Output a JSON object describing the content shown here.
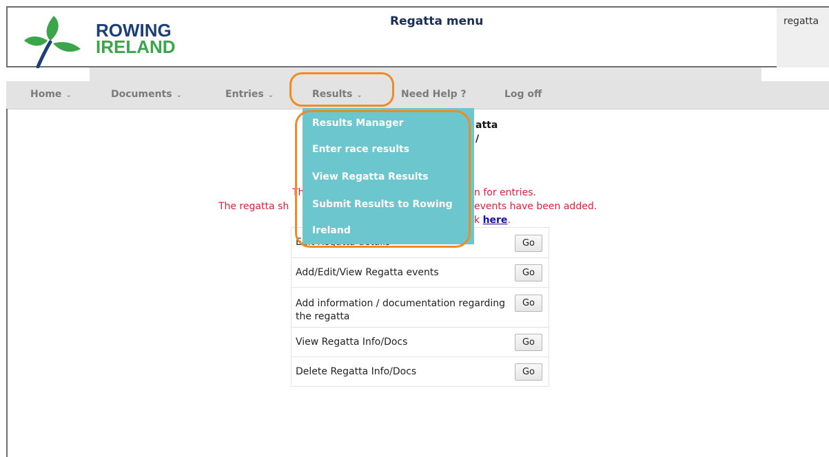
{
  "header": {
    "logo_line1": "ROWING",
    "logo_line2": "IRELAND",
    "title": "Regatta menu",
    "user_text": "regatta"
  },
  "nav": [
    {
      "label": "Home",
      "has_dropdown": true
    },
    {
      "label": "Documents",
      "has_dropdown": true
    },
    {
      "label": "Entries",
      "has_dropdown": true
    },
    {
      "label": "Results",
      "has_dropdown": true
    },
    {
      "label": "Need Help ?",
      "has_dropdown": false
    },
    {
      "label": "Log off",
      "has_dropdown": false
    }
  ],
  "dropdown": {
    "items": [
      "Results Manager",
      "Enter race results",
      "View Regatta Results",
      "Submit Results to Rowing",
      "Ireland"
    ]
  },
  "content": {
    "heading_line1_partial": "atta",
    "heading_line2_partial": "/",
    "red_line1_prefix": "Th",
    "red_line1_suffix": "n for entries.",
    "red_line2_prefix": "The regatta sh",
    "red_line2_suffix": "events have been added.",
    "red_line3_prefix": "k",
    "link_text": "here",
    "red_line3_end": "."
  },
  "operations": {
    "rows": [
      {
        "label": "Edit Regatta details",
        "button": "Go"
      },
      {
        "label": "Add/Edit/View Regatta events",
        "button": "Go"
      },
      {
        "label": "Add information / documentation regarding the regatta",
        "button": "Go"
      },
      {
        "label": "View Regatta Info/Docs",
        "button": "Go"
      },
      {
        "label": "Delete Regatta Info/Docs",
        "button": "Go"
      }
    ]
  },
  "colors": {
    "dropdown_bg": "#6bc6ce",
    "highlight_annotation": "#f08a23",
    "warning_text": "#e0203a",
    "logo_blue": "#1c3f7a",
    "logo_green": "#3aa54a"
  },
  "icons": {
    "logo": "shamrock-logo-icon",
    "nav_dropdown": "chevron-down-icon"
  }
}
